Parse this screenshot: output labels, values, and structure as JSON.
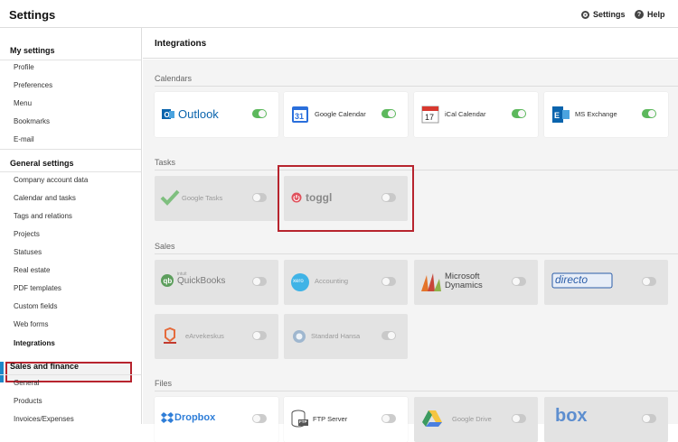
{
  "app": {
    "title": "Settings"
  },
  "top_links": {
    "settings": "Settings",
    "help": "Help"
  },
  "sidebar": {
    "sections": [
      {
        "title": "My settings",
        "items": [
          "Profile",
          "Preferences",
          "Menu",
          "Bookmarks",
          "E-mail"
        ]
      },
      {
        "title": "General settings",
        "items": [
          "Company account data",
          "Calendar and tasks",
          "Tags and relations",
          "Projects",
          "Statuses",
          "Real estate",
          "PDF templates",
          "Custom fields",
          "Web forms",
          "Integrations"
        ]
      },
      {
        "title": "Sales and finance",
        "items": [
          "General",
          "Products",
          "Invoices/Expenses"
        ]
      }
    ],
    "active_item": "Integrations"
  },
  "main": {
    "title": "Integrations"
  },
  "groups": [
    {
      "label": "Calendars",
      "cards": [
        {
          "name": "Outlook",
          "on": true
        },
        {
          "name": "Google Calendar",
          "on": true
        },
        {
          "name": "iCal Calendar",
          "on": true
        },
        {
          "name": "MS Exchange",
          "on": true
        }
      ]
    },
    {
      "label": "Tasks",
      "cards": [
        {
          "name": "Google Tasks",
          "on": false
        },
        {
          "name": "toggl",
          "on": false
        }
      ]
    },
    {
      "label": "Sales",
      "cards": [
        {
          "name": "QuickBooks",
          "brand_small": "intuit",
          "on": false
        },
        {
          "name": "Accounting",
          "brand": "xero",
          "on": false
        },
        {
          "name": "Microsoft Dynamics",
          "on": false
        },
        {
          "name": "directo",
          "on": false
        },
        {
          "name": "eArvekeskus",
          "on": false
        },
        {
          "name": "Standard Hansa",
          "on": true
        }
      ]
    },
    {
      "label": "Files",
      "cards": [
        {
          "name": "Dropbox",
          "on": false
        },
        {
          "name": "FTP Server",
          "brand_small": "FTP",
          "on": false
        },
        {
          "name": "Google Drive",
          "on": false
        },
        {
          "name": "box",
          "on": false
        }
      ]
    }
  ],
  "colors": {
    "toggle_on": "#5cb85c",
    "highlight": "#b7242e",
    "active_bar": "#1e87c8",
    "outlook": "#0a64ad",
    "google_blue": "#2a6fdb",
    "toggl_red": "#e0505b",
    "directo_blue": "#2b5da8"
  },
  "icons": {
    "calendars": [
      "outlook-logo-icon",
      "google-calendar-logo-icon",
      "ical-calendar-logo-icon",
      "ms-exchange-logo-icon"
    ],
    "tasks": [
      "google-tasks-checkmark-icon",
      "toggl-power-icon"
    ],
    "sales": [
      "quickbooks-logo-icon",
      "xero-logo-icon",
      "microsoft-dynamics-logo-icon",
      "directo-logo-icon",
      "earvekeskus-logo-icon",
      "standard-hansa-logo-icon"
    ],
    "files": [
      "dropbox-logo-icon",
      "ftp-server-icon",
      "google-drive-logo-icon",
      "box-logo-icon"
    ]
  }
}
